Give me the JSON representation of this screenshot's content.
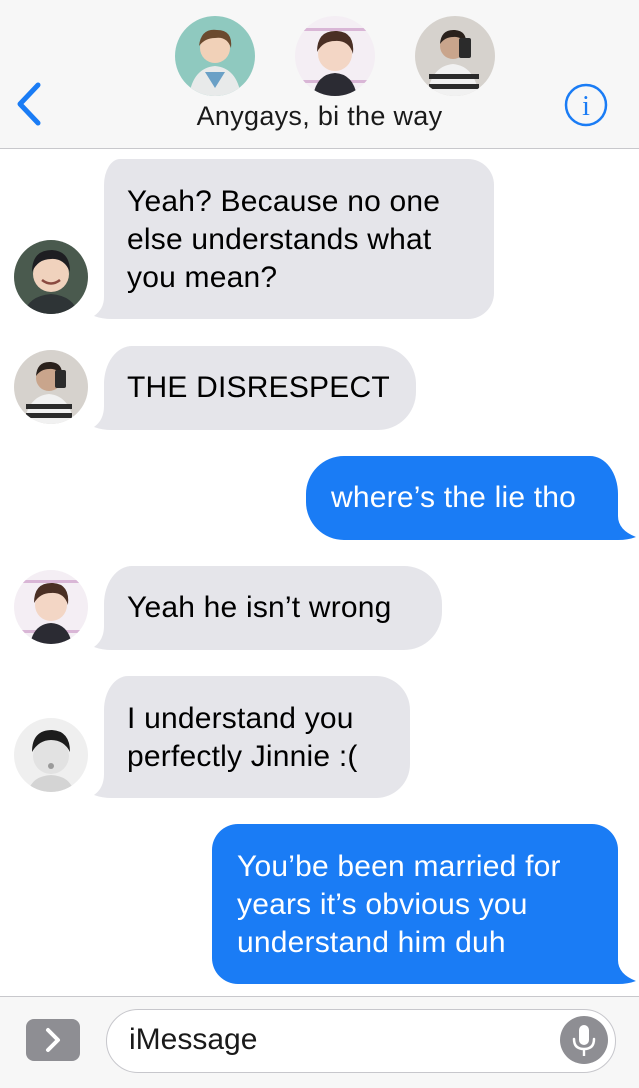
{
  "header": {
    "title": "Anygays, bi the way",
    "back_icon": "chevron-left-icon",
    "info_icon": "info-icon",
    "accent": "#1a7cf5",
    "group_avatars": [
      "avatar-1",
      "avatar-2",
      "avatar-3"
    ]
  },
  "messages": [
    {
      "side": "incoming",
      "text": "Yeah? Because no one\nelse understands what\nyou mean?",
      "avatar": "avatar-4"
    },
    {
      "side": "incoming",
      "text": "THE DISRESPECT",
      "avatar": "avatar-3"
    },
    {
      "side": "outgoing",
      "text": "where’s the lie tho"
    },
    {
      "side": "incoming",
      "text": "Yeah he isn’t wrong",
      "avatar": "avatar-2"
    },
    {
      "side": "incoming",
      "text": "I understand you\nperfectly Jinnie :(",
      "avatar": "avatar-5"
    },
    {
      "side": "outgoing",
      "text": "You’be been married for\nyears it’s obvious you\nunderstand him duh"
    }
  ],
  "colors": {
    "incoming_bubble": "#e5e5ea",
    "outgoing_bubble": "#1a7cf5"
  },
  "composer": {
    "placeholder": "iMessage",
    "apps_icon": "chevron-right-icon",
    "mic_icon": "microphone-icon"
  }
}
